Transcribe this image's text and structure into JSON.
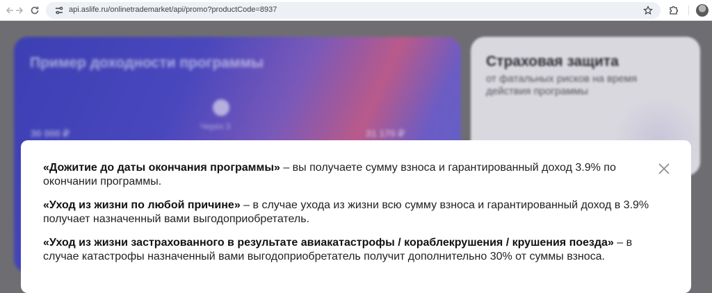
{
  "browser": {
    "url": "api.aslife.ru/onlinetrademarket/api/promo?productCode=8937",
    "icons": {
      "back": "back-arrow-icon",
      "forward": "forward-arrow-icon",
      "reload": "reload-icon",
      "site_info": "site-settings-icon",
      "bookmark": "star-icon",
      "extensions": "puzzle-icon",
      "profile": "avatar"
    }
  },
  "background": {
    "yield_card": {
      "title": "Пример доходности программы",
      "left_amount": "30 000 ₽",
      "mid_label": "Через 3",
      "right_amount": "31 170 ₽"
    },
    "insurance_card": {
      "title": "Страховая защита",
      "subtitle": "от фатальных рисков на время действия программы"
    }
  },
  "modal": {
    "items": [
      {
        "term": "«Дожитие до даты окончания программы»",
        "text": " – вы получаете сумму взноса и гарантированный доход 3.9% по окончании программы."
      },
      {
        "term": "«Уход из жизни по любой причине»",
        "text": " – в случае ухода из жизни всю сумму взноса и гарантированный доход в 3.9% получает назначенный вами выгодоприобретатель."
      },
      {
        "term": "«Уход из жизни застрахованного в результате авиакатастрофы / кораблекрушения / крушения поезда»",
        "text": " – в случае катастрофы назначенный вами выгодоприобретатель получит дополнительно 30% от суммы взноса."
      }
    ]
  }
}
